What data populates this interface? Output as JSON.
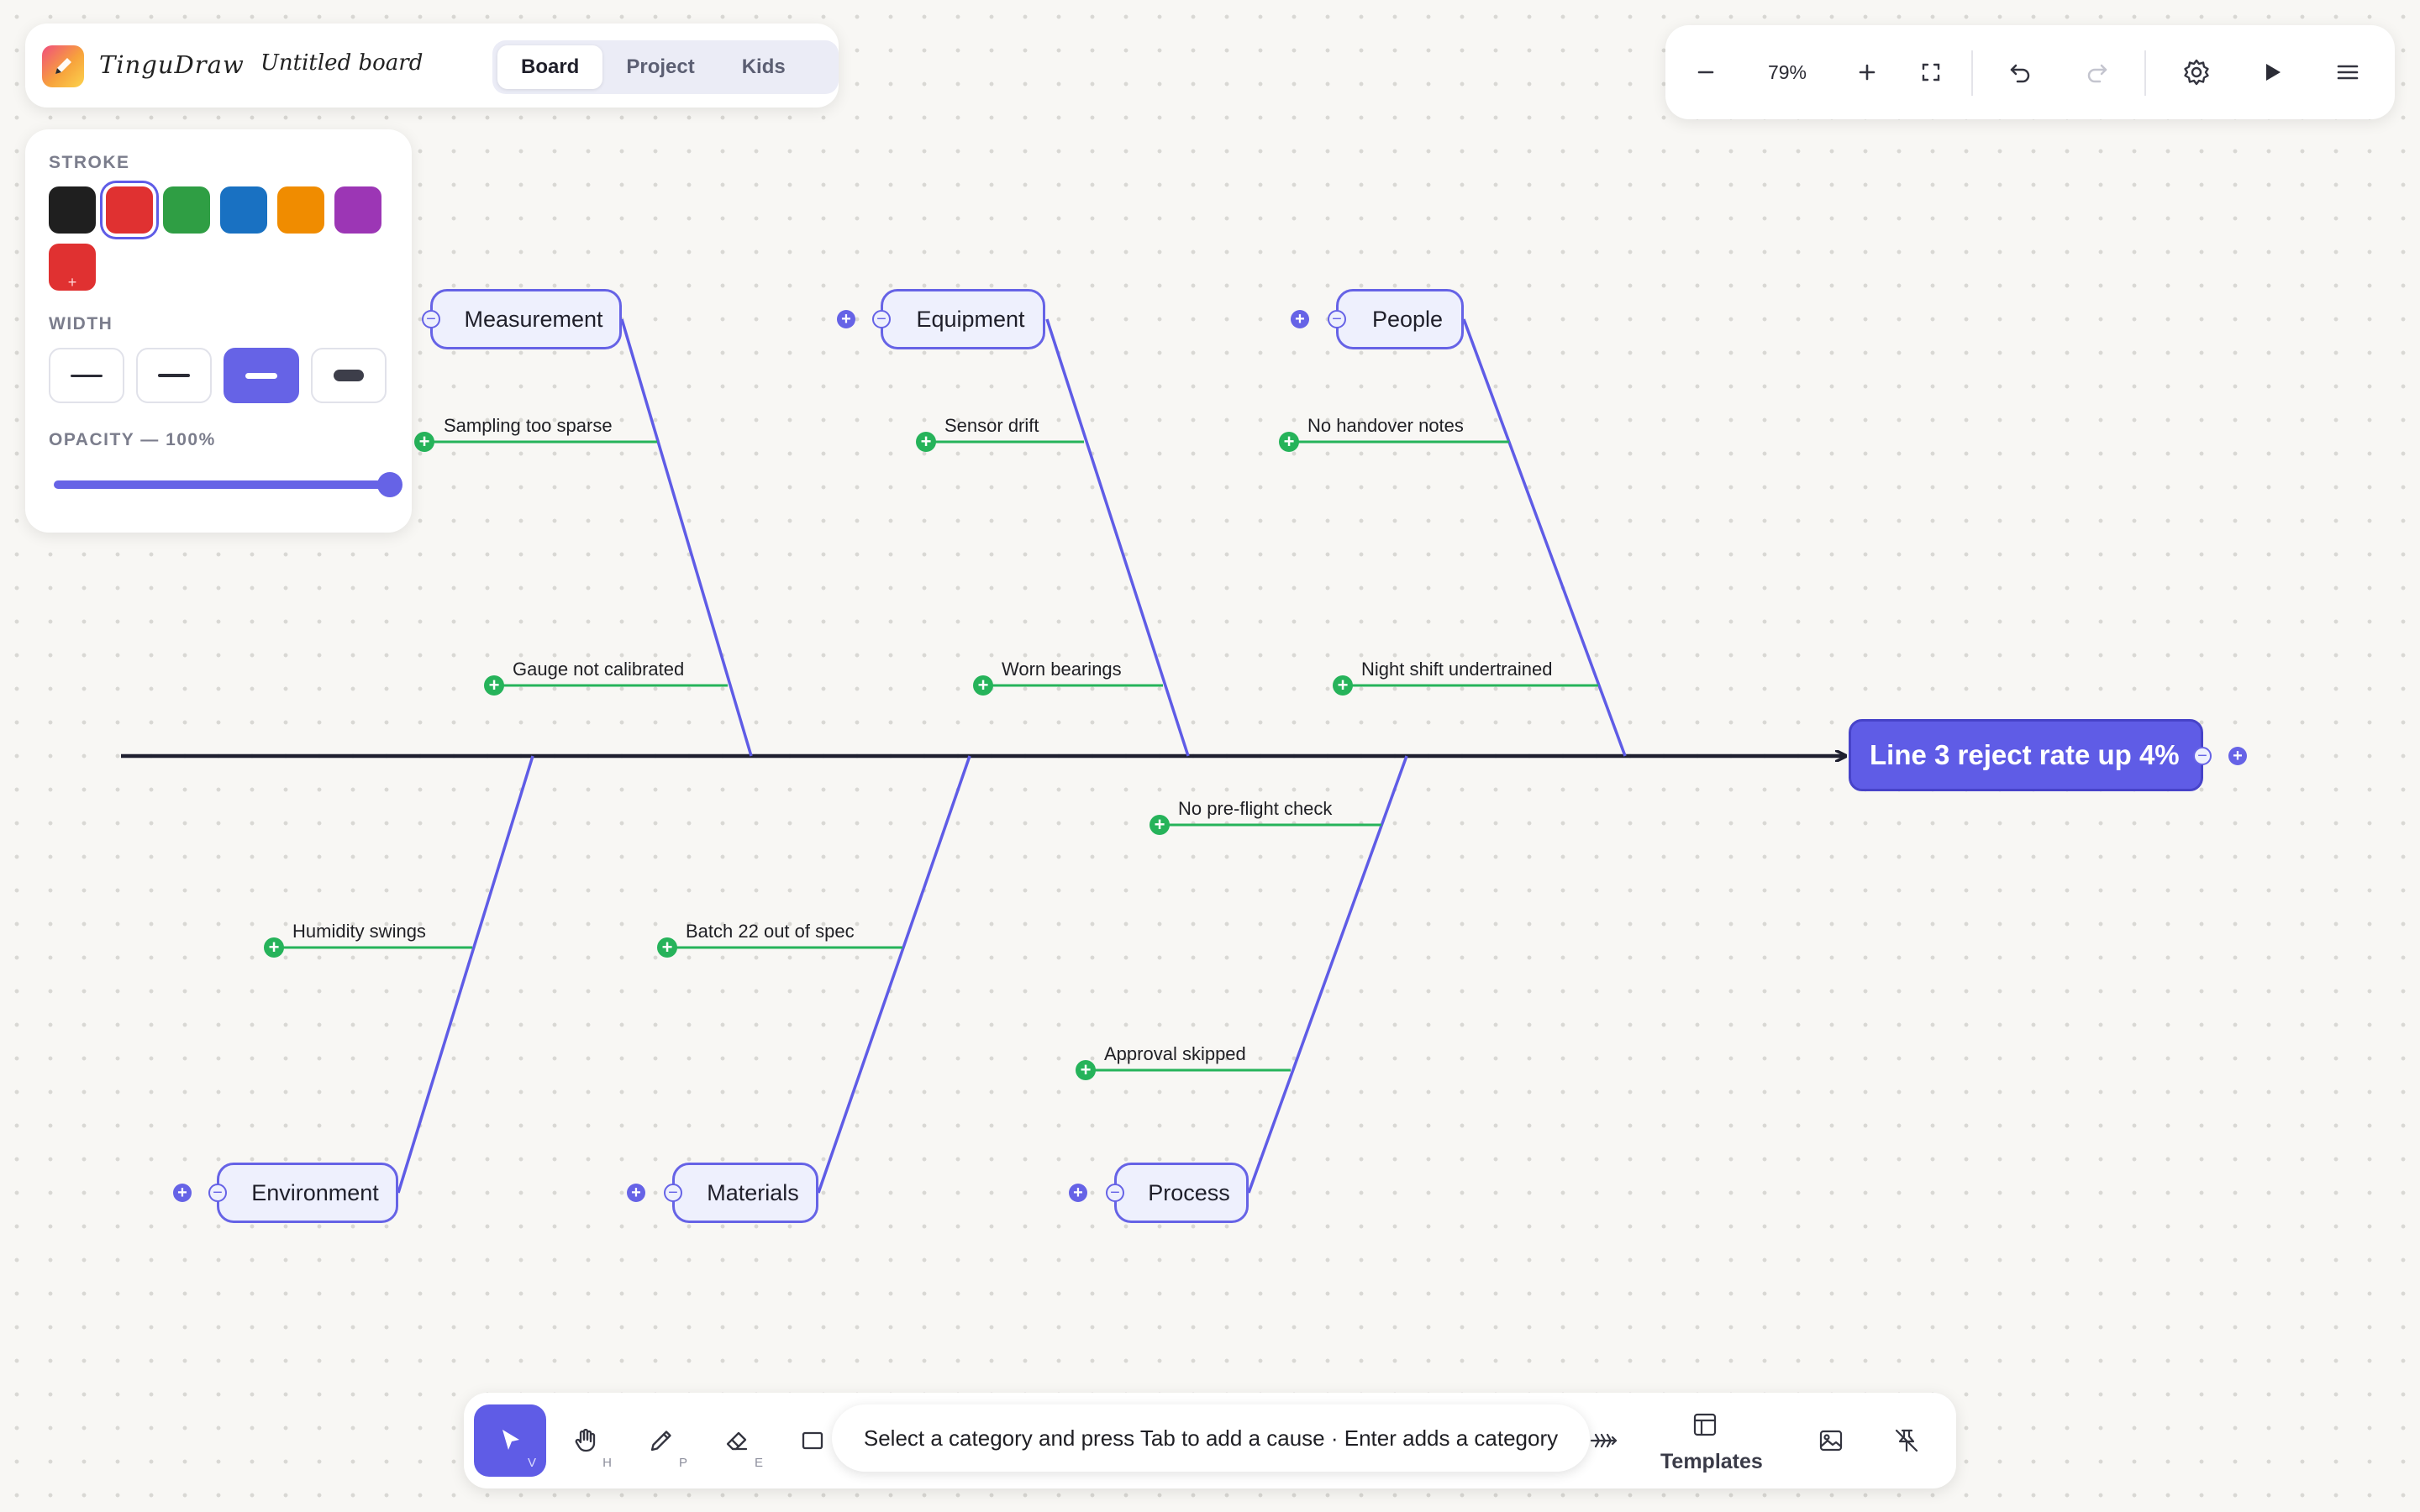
{
  "app": {
    "name": "TinguDraw",
    "board_title": "Untitled board",
    "mode_tabs": [
      "Board",
      "Project",
      "Kids"
    ],
    "active_mode": "Board"
  },
  "toolbar_right": {
    "zoom_out_icon": "minus-icon",
    "zoom_level": "79%",
    "zoom_in_icon": "plus-icon",
    "fit_icon": "fit-screen-icon",
    "undo_icon": "undo-icon",
    "redo_icon": "redo-icon",
    "settings_icon": "gear-icon",
    "present_icon": "play-icon",
    "menu_icon": "hamburger-icon"
  },
  "style_panel": {
    "stroke_label": "STROKE",
    "stroke_colors": [
      "#1f1f1f",
      "#e03131",
      "#2f9e44",
      "#1971c2",
      "#f08c00",
      "#9c36b5"
    ],
    "selected_color": "#e03131",
    "custom_color": "#e03131",
    "width_label": "WIDTH",
    "width_options": [
      "thin",
      "regular",
      "bold",
      "extra-bold"
    ],
    "active_width": "bold",
    "opacity_label": "OPACITY — 100%",
    "opacity_value": 100
  },
  "diagram": {
    "effect": "Line 3 reject rate up 4%",
    "categories": [
      {
        "name": "Measurement",
        "causes": [
          "Sampling too sparse",
          "Gauge not calibrated"
        ]
      },
      {
        "name": "Equipment",
        "causes": [
          "Sensor drift",
          "Worn bearings"
        ]
      },
      {
        "name": "People",
        "causes": [
          "No handover notes",
          "Night shift undertrained"
        ]
      },
      {
        "name": "Environment",
        "causes": [
          "Humidity swings"
        ]
      },
      {
        "name": "Materials",
        "causes": [
          "Batch 22 out of spec"
        ]
      },
      {
        "name": "Process",
        "causes": [
          "No pre-flight check",
          "Approval skipped"
        ]
      }
    ],
    "colors": {
      "accent": "#6663e6",
      "cause_line": "#26b35a",
      "spine": "#1f2030"
    }
  },
  "bottom_toolbar": {
    "tools": [
      {
        "name": "select",
        "key": "V",
        "icon": "cursor-icon"
      },
      {
        "name": "hand",
        "key": "H",
        "icon": "hand-icon"
      },
      {
        "name": "pencil",
        "key": "P",
        "icon": "pencil-icon"
      },
      {
        "name": "eraser",
        "key": "E",
        "icon": "eraser-icon"
      },
      {
        "name": "rectangle",
        "key": "",
        "icon": "rectangle-icon"
      }
    ],
    "active_tool": "select",
    "hint": "Select a category and press Tab to add a cause · Enter adds a category",
    "fishbone_icon": "fishbone-icon",
    "templates_label": "Templates",
    "image_icon": "image-icon",
    "pin_icon": "pin-off-icon"
  }
}
